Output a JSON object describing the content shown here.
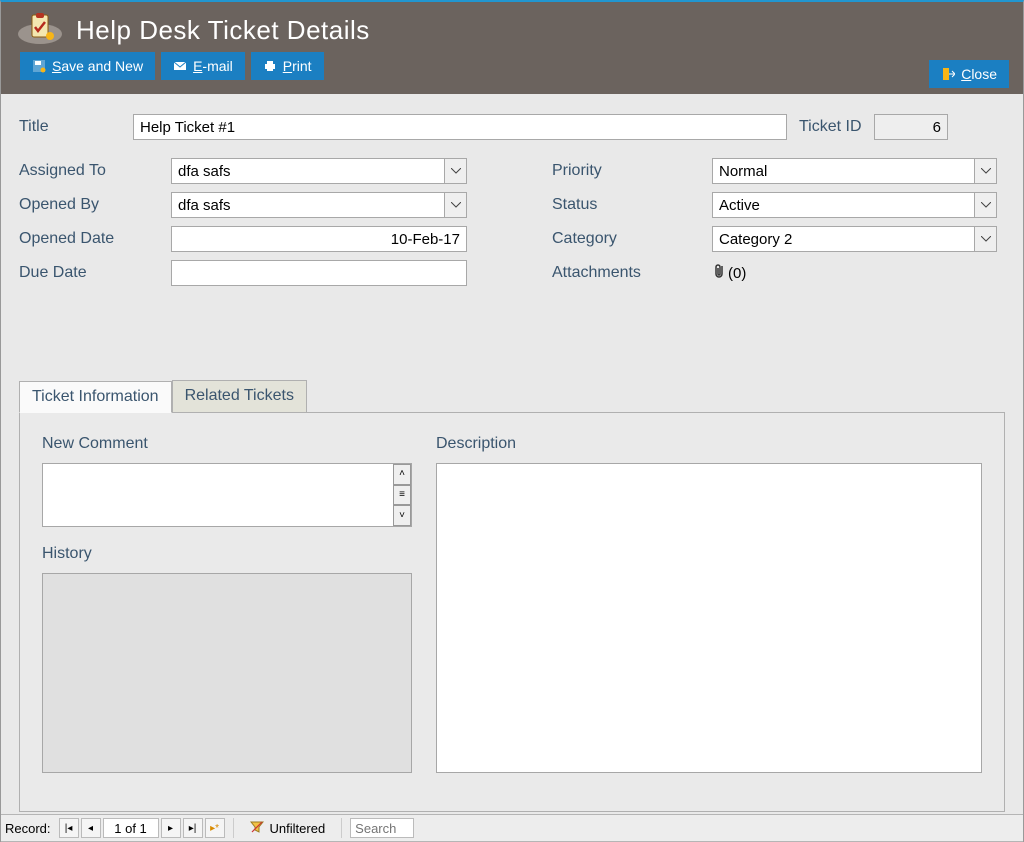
{
  "header": {
    "title": "Help Desk Ticket Details",
    "buttons": {
      "save_and_new": "Save and New",
      "email": "E-mail",
      "print": "Print",
      "close": "Close"
    }
  },
  "form": {
    "title_label": "Title",
    "title_value": "Help Ticket #1",
    "ticket_id_label": "Ticket ID",
    "ticket_id_value": "6",
    "left": {
      "assigned_to_label": "Assigned To",
      "assigned_to_value": "dfa safs",
      "opened_by_label": "Opened By",
      "opened_by_value": "dfa safs",
      "opened_date_label": "Opened Date",
      "opened_date_value": "10-Feb-17",
      "due_date_label": "Due Date",
      "due_date_value": ""
    },
    "right": {
      "priority_label": "Priority",
      "priority_value": "Normal",
      "status_label": "Status",
      "status_value": "Active",
      "category_label": "Category",
      "category_value": "Category 2",
      "attachments_label": "Attachments",
      "attachments_value": "(0)"
    }
  },
  "tabs": {
    "ticket_information": "Ticket Information",
    "related_tickets": "Related Tickets"
  },
  "tabbody": {
    "new_comment": "New Comment",
    "history": "History",
    "description": "Description"
  },
  "recordbar": {
    "label": "Record:",
    "position": "1 of 1",
    "unfiltered": "Unfiltered",
    "search_placeholder": "Search"
  }
}
